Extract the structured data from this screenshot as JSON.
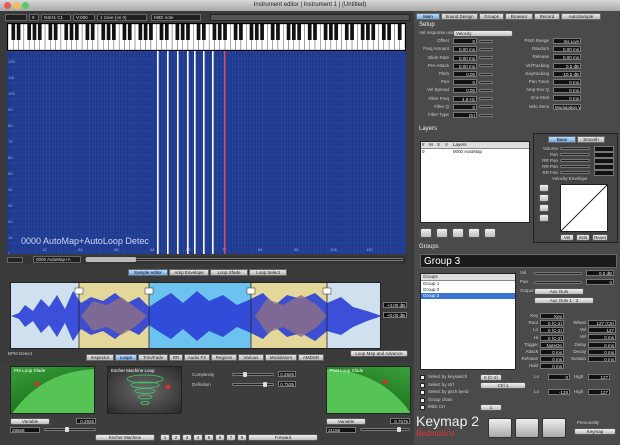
{
  "window": {
    "title": "Instrument editor | Instrument 1 | (Untitled)"
  },
  "toolbar": {
    "field1": "",
    "field2": "0",
    "field3": "NSH1 C1",
    "field4": "V:000",
    "field5": "1 zone (on 0)",
    "field6": "MIDI note"
  },
  "mapping": {
    "overlay_text": "0000 AutoMap+AutoLoop Detec",
    "zone_selector": "0000 AutoMap+A",
    "ruler_top": [
      "24",
      "36",
      "48",
      "60",
      "72",
      "84",
      "96",
      "108",
      "120"
    ],
    "ruler_left": [
      "120",
      "110",
      "100",
      "90",
      "80",
      "70",
      "60",
      "50",
      "40",
      "30",
      "20",
      "10",
      "0"
    ],
    "ruler_bottom": [
      "12",
      "24",
      "36",
      "48",
      "60",
      "72",
      "84",
      "96",
      "108",
      "120"
    ]
  },
  "editor_tabs": [
    "Sample editor",
    "Amp Envelope",
    "Loop Xfade",
    "Loop Select"
  ],
  "waveform_labels": {
    "zoom_label": "+4.00 dB",
    "zoom_value": "+0.00 dB",
    "bottom_left": "BPM Detect",
    "bottom_right": "Loop Map and Advance"
  },
  "sub_tabs": [
    "Inspector",
    "Loops",
    "Trim/Fade",
    "RR",
    "Audio FX",
    "Regions",
    "Various",
    "Modulators",
    "AMDSR"
  ],
  "loops_panel": {
    "pre_loop_title": "Pre Loop Xfade",
    "escher_title": "Escher Machine Loop",
    "post_loop_title": "Post Loop Xfade",
    "complexity_label": "Complexity",
    "complexity_value": "0.2926",
    "definition_label": "Definition",
    "definition_value": "0.7535",
    "pre_variable": "Variable",
    "pre_value_a": "0.2926",
    "pre_value_b": "28558",
    "post_variable": "Variable",
    "post_value_a": "0.7575",
    "post_value_b": "31156",
    "escher_button": "Escher Machine",
    "forward_button": "Forward",
    "numbers": [
      "1",
      "2",
      "3",
      "4",
      "5",
      "6",
      "7",
      "8"
    ]
  },
  "right_tabs": [
    "Main",
    "Sound Design",
    "Groups",
    "Browser",
    "Record",
    "AutoSample"
  ],
  "setup": {
    "title": "Setup",
    "rows": [
      {
        "l": "Vel response using",
        "v": "Velocity"
      },
      {
        "l": "Offset",
        "v": "0"
      },
      {
        "l": "Freq Amount",
        "v": "0.00 ms"
      },
      {
        "l": "Glide Rate",
        "v": "0.00 ms"
      },
      {
        "l": "Pre-Attack",
        "v": "0.00 ms"
      },
      {
        "l": "Pitch",
        "v": "0.00"
      },
      {
        "l": "Pan",
        "v": "0"
      },
      {
        "l": "Vel Spread",
        "v": "0.00"
      },
      {
        "l": "Filter Freq",
        "v": "4.8 Hz"
      },
      {
        "l": "Filter Q",
        "v": "0"
      },
      {
        "l": "Filter Type",
        "v": "Ort"
      }
    ],
    "rows_right": [
      {
        "l": "Pitch Range",
        "v": "Ins Live"
      },
      {
        "l": "Random",
        "v": "0.00 ms"
      },
      {
        "l": "Release",
        "v": "0.00 ms"
      },
      {
        "l": "VelTracking",
        "v": "0.0 dB"
      },
      {
        "l": "Keytracking",
        "v": "-10.0 dB"
      },
      {
        "l": "Pan Track",
        "v": "0 ms"
      },
      {
        "l": "Amp Env Q",
        "v": "0 ms"
      },
      {
        "l": "Env Mod",
        "v": "0 ms"
      },
      {
        "l": "Velo Sens",
        "v": "Modulation Whe"
      }
    ],
    "extra": "Ort"
  },
  "layers": {
    "title": "Layers",
    "headers": [
      "#",
      "M",
      "S",
      "V",
      "Layers"
    ],
    "row": {
      "num": "0",
      "name": "0000 AutoMap"
    },
    "side_tabs": [
      "Base",
      "Smooth"
    ],
    "side_labels": [
      "Volume",
      "Pan",
      "RR Pan",
      "RR Pan",
      "RR Fan",
      "Crossfade"
    ],
    "envelope_label": "Velocity Envelope",
    "bottom_buttons": [
      "Vel",
      "Edit",
      "Reset"
    ]
  },
  "groups": {
    "title": "Groups",
    "name": "Group 3",
    "list_header": "Groups",
    "list": [
      "Group 1",
      "Group 2",
      "Group 3"
    ],
    "right_rows": [
      {
        "l": "Vol",
        "v": "0.0 dB"
      },
      {
        "l": "Pan",
        "v": "0"
      },
      {
        "l": "Output",
        "v": "Aux Outs"
      },
      {
        "l": "",
        "v": "Aux Outs 1 - 2"
      }
    ],
    "mid_rows": [
      {
        "l": "Key",
        "v": "Key"
      },
      {
        "l": "Root",
        "v": "0 (C-2)"
      },
      {
        "l": "Lo",
        "v": "0 (C-2)"
      },
      {
        "l": "Hi",
        "v": "0 (C-2)"
      },
      {
        "l": "Trigger",
        "v": "NoteOn"
      },
      {
        "l": "Attack",
        "v": "0 ms"
      },
      {
        "l": "Release",
        "v": "0 ms"
      },
      {
        "l": "Hold",
        "v": "0 ms"
      }
    ],
    "mid_right": [
      {
        "l": "Wheel",
        "v": "127 (C8)"
      },
      {
        "l": "Vel",
        "v": "127"
      },
      {
        "l": "Vel",
        "v": "0 ms"
      },
      {
        "l": "Delay",
        "v": "0 ms"
      },
      {
        "l": "Decay",
        "v": "0 ms"
      },
      {
        "l": "Sustain",
        "v": "0 ms"
      }
    ],
    "checks": [
      "Select by keyswitch",
      "Select by ctrl",
      "Select by pitch bend",
      "Group chain",
      "MIDI CH"
    ],
    "check_values": [
      "0 (C-2)",
      "Ctrl 1",
      "",
      "",
      "1"
    ],
    "lo_hi": [
      {
        "l": "Lo",
        "v": "0"
      },
      {
        "l": "High",
        "v": "127"
      },
      {
        "l": "Lo",
        "v": "-128"
      },
      {
        "l": "High",
        "v": "127"
      }
    ]
  },
  "footer": {
    "logo_text": "Keymap 2",
    "logo_brand": "Redmatica",
    "personality_label": "Personality",
    "personality_value": "Keymap"
  }
}
